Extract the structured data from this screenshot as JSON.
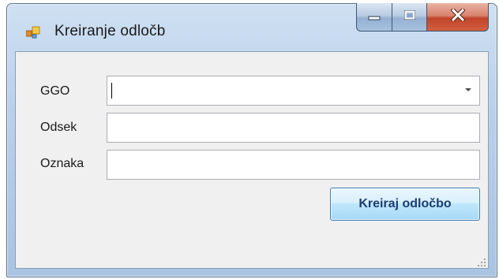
{
  "window": {
    "title": "Kreiranje odločb",
    "controls": {
      "minimize_icon": "minimize-icon",
      "maximize_icon": "maximize-icon",
      "close_icon": "close-icon"
    },
    "colors": {
      "close_button": "#c8482b",
      "frame": "#b9d0ea"
    }
  },
  "form": {
    "ggo": {
      "label": "GGO",
      "value": ""
    },
    "odsek": {
      "label": "Odsek",
      "value": ""
    },
    "oznaka": {
      "label": "Oznaka",
      "value": ""
    },
    "submit_label": "Kreiraj odločbo"
  }
}
